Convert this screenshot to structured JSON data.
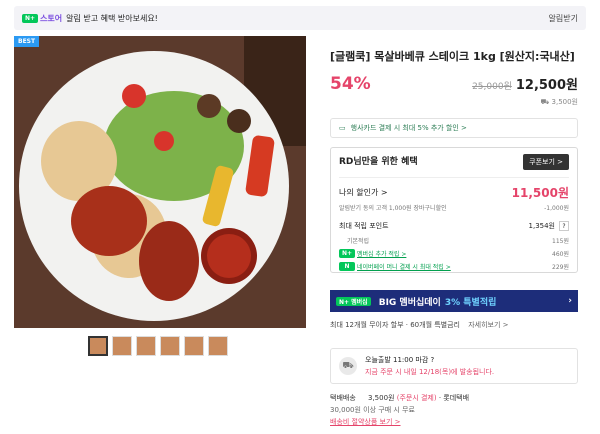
{
  "topbar": {
    "nplus": "N+",
    "store": "스토어",
    "notice": "알림 받고 혜택 받아보세요!",
    "right_label": "알림받기"
  },
  "gallery": {
    "badge": "BEST",
    "thumb_count": 6
  },
  "product": {
    "title": "[글램쿡] 목살바베큐 스테이크 1kg [원산지:국내산]",
    "discount": "54%",
    "original_price": "25,000원",
    "price": "12,500원",
    "shipping_fee": "3,500원"
  },
  "card_banner": {
    "text": "행사카드 결제 시 최대 5% 추가 할인 >"
  },
  "benefit": {
    "title": "RD님만을 위한 혜택",
    "coupon_button": "쿠폰보기 >",
    "my_price_label": "나의 할인가 >",
    "my_price": "11,500원",
    "my_price_sub": "알림받기 동의 고객 1,000원 장바구니할인",
    "my_price_sub_value": "-1,000원",
    "points_label": "최대 적립 포인트",
    "points_value": "1,354원",
    "points_rows": [
      {
        "label": "기본적립",
        "value": "115원"
      },
      {
        "label": "멤버십 추가 적립 >",
        "value": "460원"
      },
      {
        "label": "네이버페이 머니 결제 시 최대 적립 >",
        "value": "229원"
      }
    ]
  },
  "big_day": {
    "badge": "N+ 멤버십",
    "text": "BIG 멤버십데이",
    "highlight": "3% 특별적립"
  },
  "installment": {
    "text": "최대 12개월 무이자 할부 · 60개월 특별금리",
    "link": "자세히보기 >"
  },
  "delivery": {
    "line1": "오늘출발 11:00 마감 ?",
    "line2": "지금 주문 시 내일 12/18(목)에 발송됩니다."
  },
  "ship_info": {
    "label": "택배배송",
    "fee": "3,500원",
    "fee_note": "(주문시 결제)",
    "courier": "· 롯데택배",
    "free_condition": "30,000원 이상 구매 시 무료",
    "link": "배송비 절약상품 보기 >"
  },
  "colors": {
    "accent_pink": "#e5446a",
    "naver_green": "#03c75a",
    "big_day_bg": "#1d2d7a"
  }
}
